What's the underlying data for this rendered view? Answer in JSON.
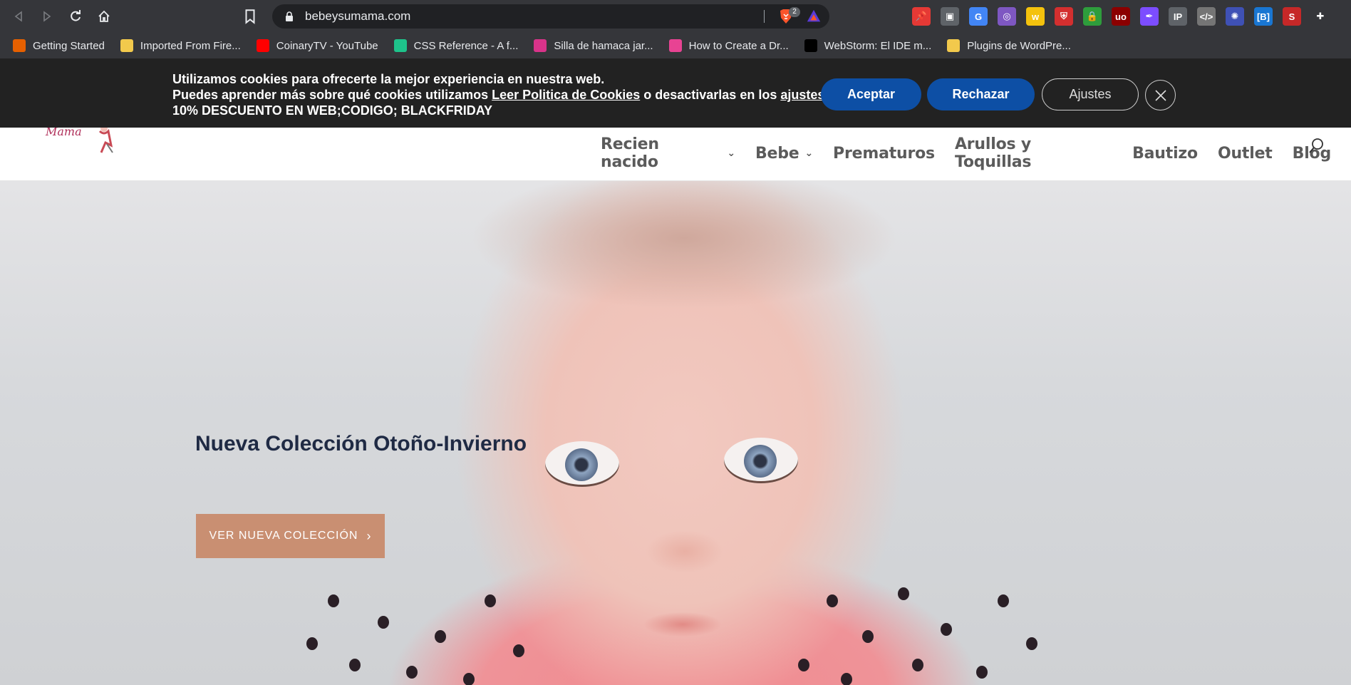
{
  "browser": {
    "url": "bebeysumama.com",
    "brave_shield_count": "2",
    "bookmarks": [
      {
        "label": "Getting Started",
        "icon": "firefox-icon",
        "color": "#e66000"
      },
      {
        "label": "Imported From Fire...",
        "icon": "folder-icon",
        "color": "#f2c94c"
      },
      {
        "label": "CoinaryTV - YouTube",
        "icon": "youtube-icon",
        "color": "#ff0000"
      },
      {
        "label": "CSS Reference - A f...",
        "icon": "css-reference-icon",
        "color": "#1ec38b"
      },
      {
        "label": "Silla de hamaca jar...",
        "icon": "l-logo-icon",
        "color": "#d9338a"
      },
      {
        "label": "How to Create a Dr...",
        "icon": "asterisk-logo-icon",
        "color": "#e84393"
      },
      {
        "label": "WebStorm: El IDE m...",
        "icon": "jetbrains-icon",
        "color": "#000000"
      },
      {
        "label": "Plugins de WordPre...",
        "icon": "folder-icon",
        "color": "#f2c94c"
      }
    ],
    "extensions": [
      {
        "name": "pin-extension-icon",
        "color": "#e53935",
        "glyph": "📌"
      },
      {
        "name": "window-extension-icon",
        "color": "#5f6368",
        "glyph": "▣"
      },
      {
        "name": "google-translate-icon",
        "color": "#4285f4",
        "glyph": "G"
      },
      {
        "name": "color-picker-icon",
        "color": "#7e57c2",
        "glyph": "◎"
      },
      {
        "name": "w-extension-icon",
        "color": "#f4c20d",
        "glyph": "w"
      },
      {
        "name": "shield-extension-icon",
        "color": "#d32f2f",
        "glyph": "⛨"
      },
      {
        "name": "lock-extension-icon",
        "color": "#2e9d3c",
        "glyph": "🔒"
      },
      {
        "name": "ublock-icon",
        "color": "#8b0000",
        "glyph": "uo"
      },
      {
        "name": "feather-extension-icon",
        "color": "#7c4dff",
        "glyph": "✒"
      },
      {
        "name": "ip-extension-icon",
        "color": "#5f6368",
        "glyph": "IP"
      },
      {
        "name": "code-extension-icon",
        "color": "#757575",
        "glyph": "</>"
      },
      {
        "name": "gear-star-extension-icon",
        "color": "#3f51b5",
        "glyph": "✺"
      },
      {
        "name": "bracket-extension-icon",
        "color": "#1976d2",
        "glyph": "[B]"
      },
      {
        "name": "seo-extension-icon",
        "color": "#c62828",
        "glyph": "S"
      },
      {
        "name": "puzzle-extensions-icon",
        "color": "#35363a",
        "glyph": "✚"
      }
    ]
  },
  "cookie": {
    "line1": "Utilizamos cookies para ofrecerte la mejor experiencia en nuestra web.",
    "line2_prefix": "Puedes aprender más sobre qué cookies utilizamos ",
    "policy_link": "Leer Politica de Cookies",
    "line2_middle": " o desactivarlas en los ",
    "settings_link": "ajustes",
    "line2_suffix": ".",
    "line3": "10% DESCUENTO EN WEB;CODIGO; BLACKFRIDAY",
    "accept_label": "Aceptar",
    "reject_label": "Rechazar",
    "settings_label": "Ajustes"
  },
  "site": {
    "logo_text": "Mama",
    "nav": [
      {
        "label": "Recien nacido",
        "has_dropdown": true
      },
      {
        "label": "Bebe",
        "has_dropdown": true
      },
      {
        "label": "Prematuros",
        "has_dropdown": false
      },
      {
        "label": "Arullos y Toquillas",
        "has_dropdown": false
      },
      {
        "label": "Bautizo",
        "has_dropdown": false
      },
      {
        "label": "Outlet",
        "has_dropdown": false
      },
      {
        "label": "Blog",
        "has_dropdown": false
      }
    ],
    "hero": {
      "title": "Nueva Colección Otoño-Invierno",
      "button_label": "VER NUEVA COLECCIÓN",
      "button_arrow": "›",
      "button_color": "#c98f72",
      "title_color": "#1f2a44"
    }
  }
}
